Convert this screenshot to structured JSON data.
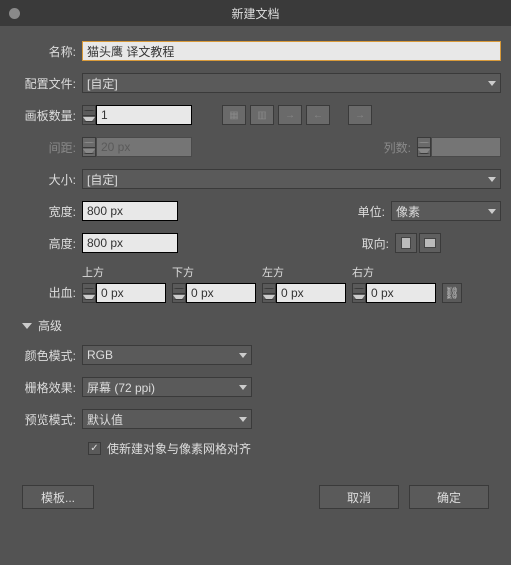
{
  "title": "新建文档",
  "name": {
    "label": "名称:",
    "value": "猫头鹰 译文教程"
  },
  "profile": {
    "label": "配置文件:",
    "value": "[自定]"
  },
  "artboards": {
    "label": "画板数量:",
    "value": "1"
  },
  "spacing": {
    "label": "间距:",
    "value": "20 px"
  },
  "columns": {
    "label": "列数:",
    "value": ""
  },
  "size": {
    "label": "大小:",
    "value": "[自定]"
  },
  "width": {
    "label": "宽度:",
    "value": "800 px"
  },
  "units": {
    "label": "单位:",
    "value": "像素"
  },
  "height": {
    "label": "高度:",
    "value": "800 px"
  },
  "orient": {
    "label": "取向:"
  },
  "bleed": {
    "label": "出血:",
    "top": {
      "label": "上方",
      "value": "0 px"
    },
    "bottom": {
      "label": "下方",
      "value": "0 px"
    },
    "left": {
      "label": "左方",
      "value": "0 px"
    },
    "right": {
      "label": "右方",
      "value": "0 px"
    }
  },
  "advanced": {
    "label": "高级"
  },
  "colorMode": {
    "label": "颜色模式:",
    "value": "RGB"
  },
  "raster": {
    "label": "栅格效果:",
    "value": "屏幕 (72 ppi)"
  },
  "preview": {
    "label": "预览模式:",
    "value": "默认值"
  },
  "alignGrid": {
    "label": "使新建对象与像素网格对齐"
  },
  "buttons": {
    "template": "模板...",
    "cancel": "取消",
    "ok": "确定"
  }
}
